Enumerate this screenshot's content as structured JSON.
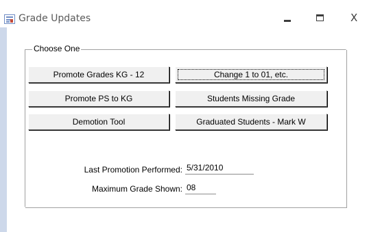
{
  "window": {
    "title": "Grade Updates",
    "icon": "form-icon",
    "controls": {
      "minimize_icon": "minimize-icon",
      "maximize_icon": "maximize-icon",
      "close_label": "X"
    }
  },
  "group": {
    "legend": "Choose One"
  },
  "buttons": {
    "promote_kg12": "Promote Grades KG - 12",
    "change_1_to_01": "Change 1 to 01, etc.",
    "promote_ps_kg": "Promote PS to KG",
    "students_missing_grade": "Students Missing Grade",
    "demotion_tool": "Demotion Tool",
    "graduated_students": "Graduated Students - Mark W"
  },
  "fields": {
    "last_promotion": {
      "label": "Last Promotion Performed:",
      "value": "5/31/2010"
    },
    "max_grade": {
      "label": "Maximum Grade Shown:",
      "value": "08"
    }
  },
  "colors": {
    "window_edge": "#cdd8ea",
    "button_face": "#f0f0f0",
    "title_text": "#5a5a5a"
  }
}
